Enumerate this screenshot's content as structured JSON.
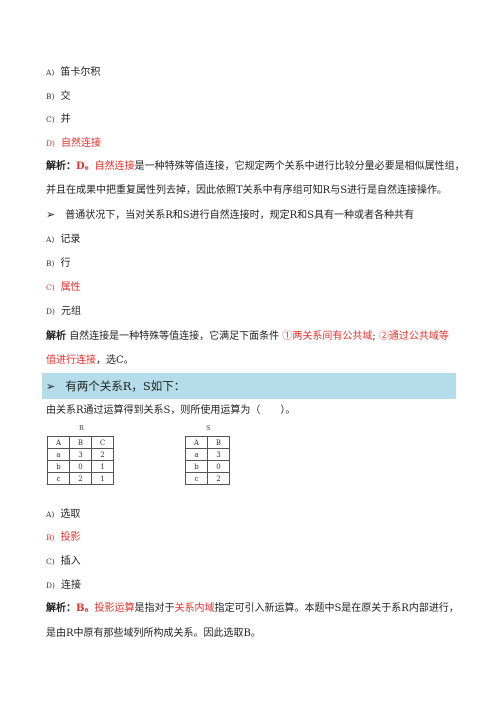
{
  "q1": {
    "options": [
      {
        "letter": "A)",
        "text": "笛卡尔积",
        "correct": false
      },
      {
        "letter": "B)",
        "text": "交",
        "correct": false
      },
      {
        "letter": "C)",
        "text": "并",
        "correct": false
      },
      {
        "letter": "D)",
        "text": "自然连接",
        "correct": true
      }
    ],
    "analysis": {
      "label": "解析：",
      "answer": "D。",
      "term": "自然连接",
      "line1_rest": "是一种特殊等值连接，它规定两个关系中进行比较分量必要是相似属性组，",
      "line2": "并且在成果中把重复属性列去掉，因此依照T关系中有序组可知R与S进行是自然连接操作。"
    }
  },
  "q2": {
    "bullet": "➢",
    "question": "普通状况下，当对关系R和S进行自然连接时，规定R和S具有一种或者各种共有",
    "options": [
      {
        "letter": "A)",
        "text": "记录",
        "correct": false
      },
      {
        "letter": "B)",
        "text": "行",
        "correct": false
      },
      {
        "letter": "C)",
        "text": "属性",
        "correct": true
      },
      {
        "letter": "D)",
        "text": "元组",
        "correct": false
      }
    ],
    "analysis": {
      "label": "解析",
      "line1_pre": "自然连接是一种特殊等值连接，它满足下面条件",
      "cond1": "①两关系间有公共域",
      "cond2_a": "②通过公共域等",
      "cond2_b": "值进行连接",
      "line2_rest": "，选C。"
    }
  },
  "q3": {
    "bullet": "➢",
    "heading": "有两个关系R，S如下：",
    "question": "由关系R通过运算得到关系S，则所使用运算为（　　）。",
    "relation_r": {
      "name": "R",
      "headers": [
        "A",
        "B",
        "C"
      ],
      "rows": [
        [
          "a",
          "3",
          "2"
        ],
        [
          "b",
          "0",
          "1"
        ],
        [
          "c",
          "2",
          "1"
        ]
      ]
    },
    "relation_s": {
      "name": "S",
      "headers": [
        "A",
        "B"
      ],
      "rows": [
        [
          "a",
          "3"
        ],
        [
          "b",
          "0"
        ],
        [
          "c",
          "2"
        ]
      ]
    },
    "options": [
      {
        "letter": "A)",
        "text": "选取",
        "correct": false
      },
      {
        "letter": "B)",
        "text": "投影",
        "correct": true
      },
      {
        "letter": "C)",
        "text": "插入",
        "correct": false
      },
      {
        "letter": "D)",
        "text": "连接",
        "correct": false
      }
    ],
    "analysis": {
      "label": "解析：",
      "answer": "B。",
      "term1": "投影运算",
      "mid": "是指对于",
      "term2": "关系内域",
      "line1_rest": "指定可引入新运算。本题中S是在原关于系R内部进行，",
      "line2": "是由R中原有那些域列所构成关系。因此选取B。"
    }
  },
  "colors": {
    "accent_red": "#e0332e",
    "heading_band": "#b5dde9"
  }
}
